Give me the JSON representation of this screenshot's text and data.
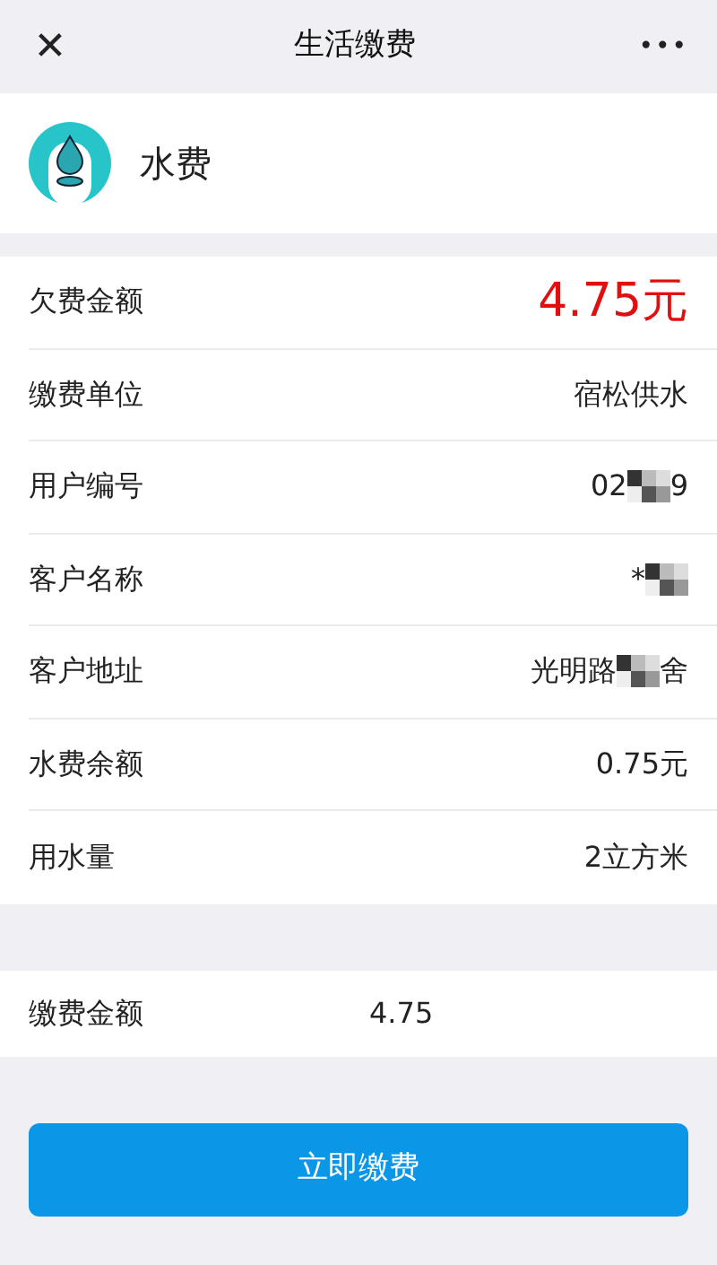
{
  "nav": {
    "close": "✕",
    "title": "生活缴费",
    "more": "•••"
  },
  "service": {
    "name": "水费"
  },
  "rows": [
    {
      "label": "欠费金额",
      "kind": "amount",
      "parts": [
        {
          "kind": "text",
          "text": "4.75元"
        }
      ]
    },
    {
      "label": "缴费单位",
      "kind": "plain",
      "parts": [
        {
          "kind": "text",
          "text": "宿松供水"
        }
      ]
    },
    {
      "label": "用户编号",
      "kind": "plain",
      "parts": [
        {
          "kind": "text",
          "text": "02"
        },
        {
          "kind": "mosaic"
        },
        {
          "kind": "text",
          "text": "9"
        }
      ]
    },
    {
      "label": "客户名称",
      "kind": "plain",
      "parts": [
        {
          "kind": "text",
          "text": "*"
        },
        {
          "kind": "mosaic"
        }
      ]
    },
    {
      "label": "客户地址",
      "kind": "plain",
      "parts": [
        {
          "kind": "text",
          "text": "光明路"
        },
        {
          "kind": "mosaic"
        },
        {
          "kind": "text",
          "text": "舍"
        }
      ]
    },
    {
      "label": "水费余额",
      "kind": "plain",
      "parts": [
        {
          "kind": "text",
          "text": "0.75元"
        }
      ]
    },
    {
      "label": "用水量",
      "kind": "plain",
      "parts": [
        {
          "kind": "text",
          "text": "2立方米"
        }
      ]
    }
  ],
  "payment": {
    "label": "缴费金额",
    "value": "4.75"
  },
  "pay_button": "立即缴费"
}
